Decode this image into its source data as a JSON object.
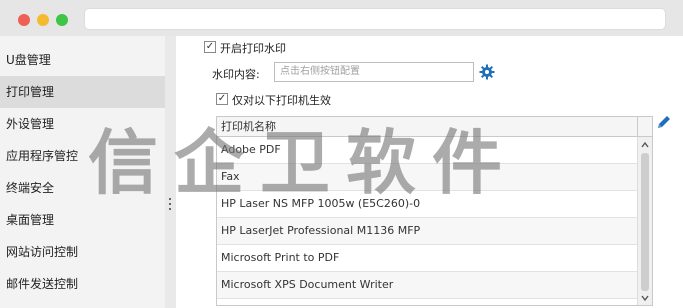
{
  "sidebar": {
    "items": [
      {
        "label": "U盘管理"
      },
      {
        "label": "打印管理"
      },
      {
        "label": "外设管理"
      },
      {
        "label": "应用程序管控"
      },
      {
        "label": "终端安全"
      },
      {
        "label": "桌面管理"
      },
      {
        "label": "网站访问控制"
      },
      {
        "label": "邮件发送控制"
      }
    ],
    "active_index": 1
  },
  "settings": {
    "enable_watermark_label": "开启打印水印",
    "enable_watermark_checked": true,
    "content_label": "水印内容:",
    "content_placeholder": "点击右侧按钮配置",
    "only_printers_label": "仅对以下打印机生效",
    "only_printers_checked": true
  },
  "printer_table": {
    "header": "打印机名称",
    "rows": [
      "Adobe PDF",
      "Fax",
      "HP Laser NS MFP 1005w (E5C260)-0",
      "HP LaserJet Professional M1136 MFP",
      "Microsoft Print to PDF",
      "Microsoft XPS Document Writer"
    ]
  },
  "watermark_overlay": "信企卫软件",
  "colors": {
    "accent": "#1f6fb8",
    "active_nav": "#dcdcdc"
  },
  "icons": [
    "gear-icon",
    "pencil-icon",
    "chevron-up-icon",
    "chevron-down-icon",
    "check-icon"
  ]
}
